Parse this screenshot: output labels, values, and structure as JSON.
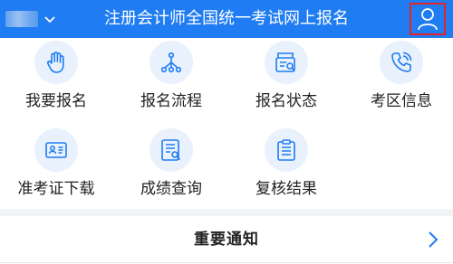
{
  "header": {
    "title": "注册会计师全国统一考试网上报名",
    "bg_color": "#1f7cf2",
    "region_icon": "chevron-down-icon",
    "user_icon": "user-icon",
    "user_highlight_color": "#e42525"
  },
  "menu": [
    {
      "label": "我要报名",
      "icon": "hand-icon"
    },
    {
      "label": "报名流程",
      "icon": "flow-icon"
    },
    {
      "label": "报名状态",
      "icon": "status-icon"
    },
    {
      "label": "考区信息",
      "icon": "phone-icon"
    },
    {
      "label": "准考证下载",
      "icon": "id-card-icon"
    },
    {
      "label": "成绩查询",
      "icon": "score-search-icon"
    },
    {
      "label": "复核结果",
      "icon": "clipboard-icon"
    }
  ],
  "notice": {
    "title": "重要通知",
    "arrow_icon": "chevron-right-icon"
  },
  "icon_color": "#1f7cf2",
  "icon_bg_color": "#e9f1fc"
}
